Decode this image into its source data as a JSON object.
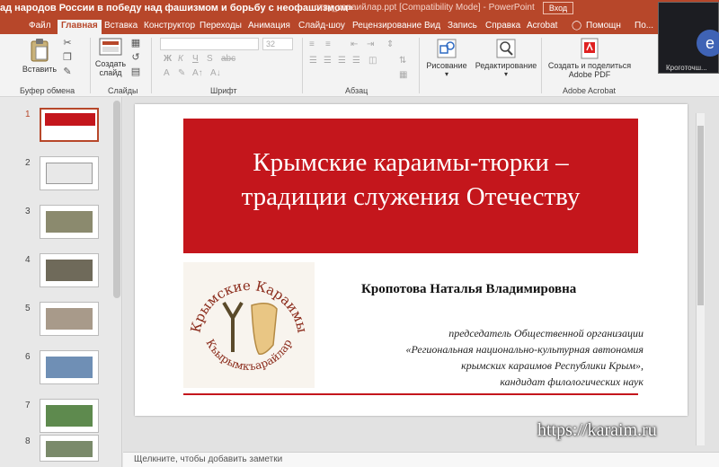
{
  "window": {
    "title": "ад народов России в победу над фашизмом и борьбу с неофашизмом»",
    "file_name": "…ству_караийлар.ppt [Compatibility Mode] - PowerPoint",
    "signin": "Вход"
  },
  "tabs": [
    {
      "label": "Файл"
    },
    {
      "label": "Главная",
      "active": true
    },
    {
      "label": "Вставка"
    },
    {
      "label": "Конструктор"
    },
    {
      "label": "Переходы"
    },
    {
      "label": "Анимация"
    },
    {
      "label": "Слайд-шоу"
    },
    {
      "label": "Рецензирование"
    },
    {
      "label": "Вид"
    },
    {
      "label": "Запись"
    },
    {
      "label": "Справка"
    },
    {
      "label": "Acrobat"
    },
    {
      "label": "Помощн"
    },
    {
      "label": "По..."
    }
  ],
  "ribbon": {
    "paste_label": "Вставить",
    "new_slide_label": "Создать слайд",
    "font_size": "32",
    "drawing_label": "Рисование",
    "editing_label": "Редактирование",
    "create_pdf_label": "Создать и поделиться Adobe PDF",
    "groups": {
      "clipboard": "Буфер обмена",
      "slides": "Слайды",
      "font": "Шрифт",
      "paragraph": "Абзац",
      "acrobat": "Adobe Acrobat"
    }
  },
  "video": {
    "name": "Кроготочш..."
  },
  "thumbnails": [
    {
      "num": "1",
      "selected": true
    },
    {
      "num": "2"
    },
    {
      "num": "3"
    },
    {
      "num": "4"
    },
    {
      "num": "5"
    },
    {
      "num": "6"
    },
    {
      "num": "7"
    },
    {
      "num": "8"
    }
  ],
  "slide": {
    "title_line1": "Крымские караимы-тюрки –",
    "title_line2": "традиции служения Отечеству",
    "logo_top": "Крымские Караимы",
    "logo_bottom": "Къырымкъарайлар",
    "author": "Кропотова Наталья Владимировна",
    "desc_line1": "председатель Общественной организации",
    "desc_line2": "«Региональная национально-культурная автономия",
    "desc_line3": "крымских караимов Республики Крым»,",
    "desc_line4": "кандидат филологических наук"
  },
  "notes_placeholder": "Щелкните, чтобы добавить заметки",
  "watermark": "https://karaim.ru",
  "colors": {
    "accent": "#b7472a",
    "slide_red": "#c4161c"
  }
}
